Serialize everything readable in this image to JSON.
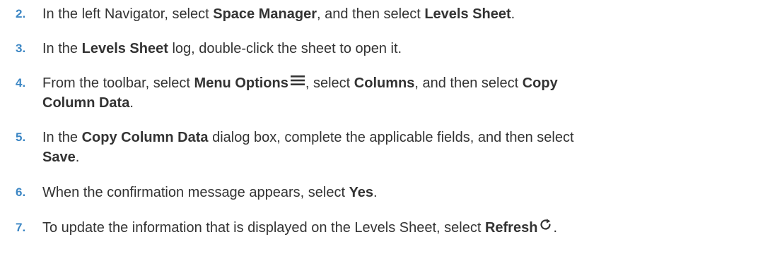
{
  "steps": [
    {
      "number": "2.",
      "parts": [
        "In the left Navigator, select ",
        "Space Manager",
        ", and then select ",
        "Levels Sheet",
        "."
      ]
    },
    {
      "number": "3.",
      "parts": [
        "In the ",
        "Levels Sheet",
        " log, double-click the sheet to open it."
      ]
    },
    {
      "number": "4.",
      "parts": [
        "From the toolbar, select ",
        "Menu Options",
        ", select ",
        "Columns",
        ", and then select ",
        "Copy",
        "Column Data",
        "."
      ]
    },
    {
      "number": "5.",
      "parts": [
        "In the ",
        "Copy Column Data",
        " dialog box, complete the applicable fields, and then select",
        "Save",
        "."
      ]
    },
    {
      "number": "6.",
      "parts": [
        "When the confirmation message appears, select ",
        "Yes",
        "."
      ]
    },
    {
      "number": "7.",
      "parts": [
        "To update the information that is displayed on the Levels Sheet, select ",
        "Refresh",
        "."
      ]
    }
  ],
  "icons": {
    "menu": "menu-options-icon",
    "refresh": "refresh-icon"
  },
  "colors": {
    "number": "#3b86c4",
    "text": "#333333"
  }
}
